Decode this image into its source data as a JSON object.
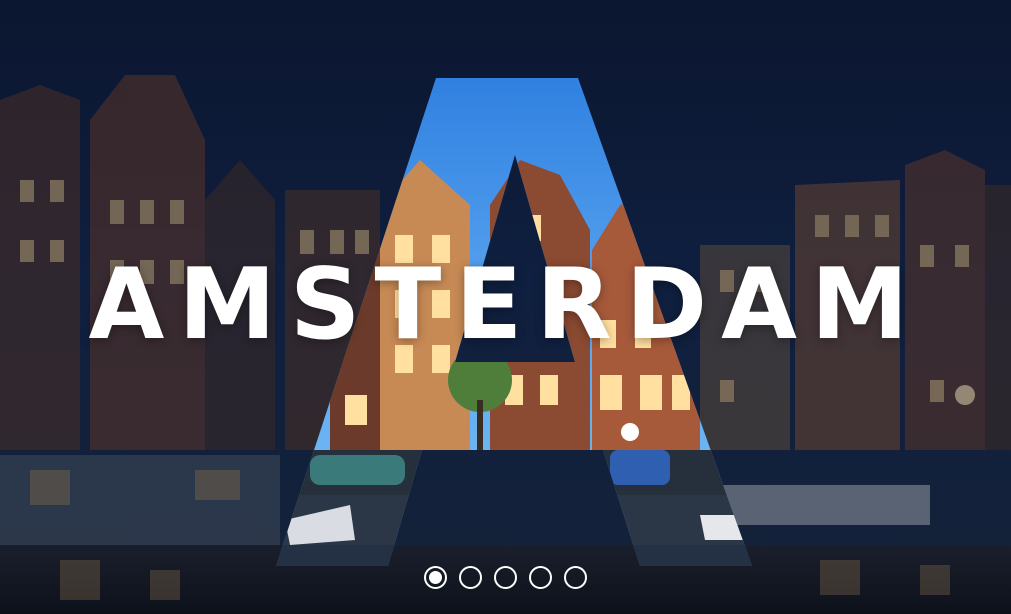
{
  "hero": {
    "title": "AMSTERDAM",
    "background_icon": "city-canal-night-photo",
    "letter_icon": "letter-a-window"
  },
  "colors": {
    "sky_top": "#0b1630",
    "sky_window": "#3f8fe0",
    "text": "#ffffff"
  },
  "pagination": {
    "count": 5,
    "active_index": 0,
    "labels": [
      "",
      "",
      "",
      "",
      ""
    ]
  }
}
